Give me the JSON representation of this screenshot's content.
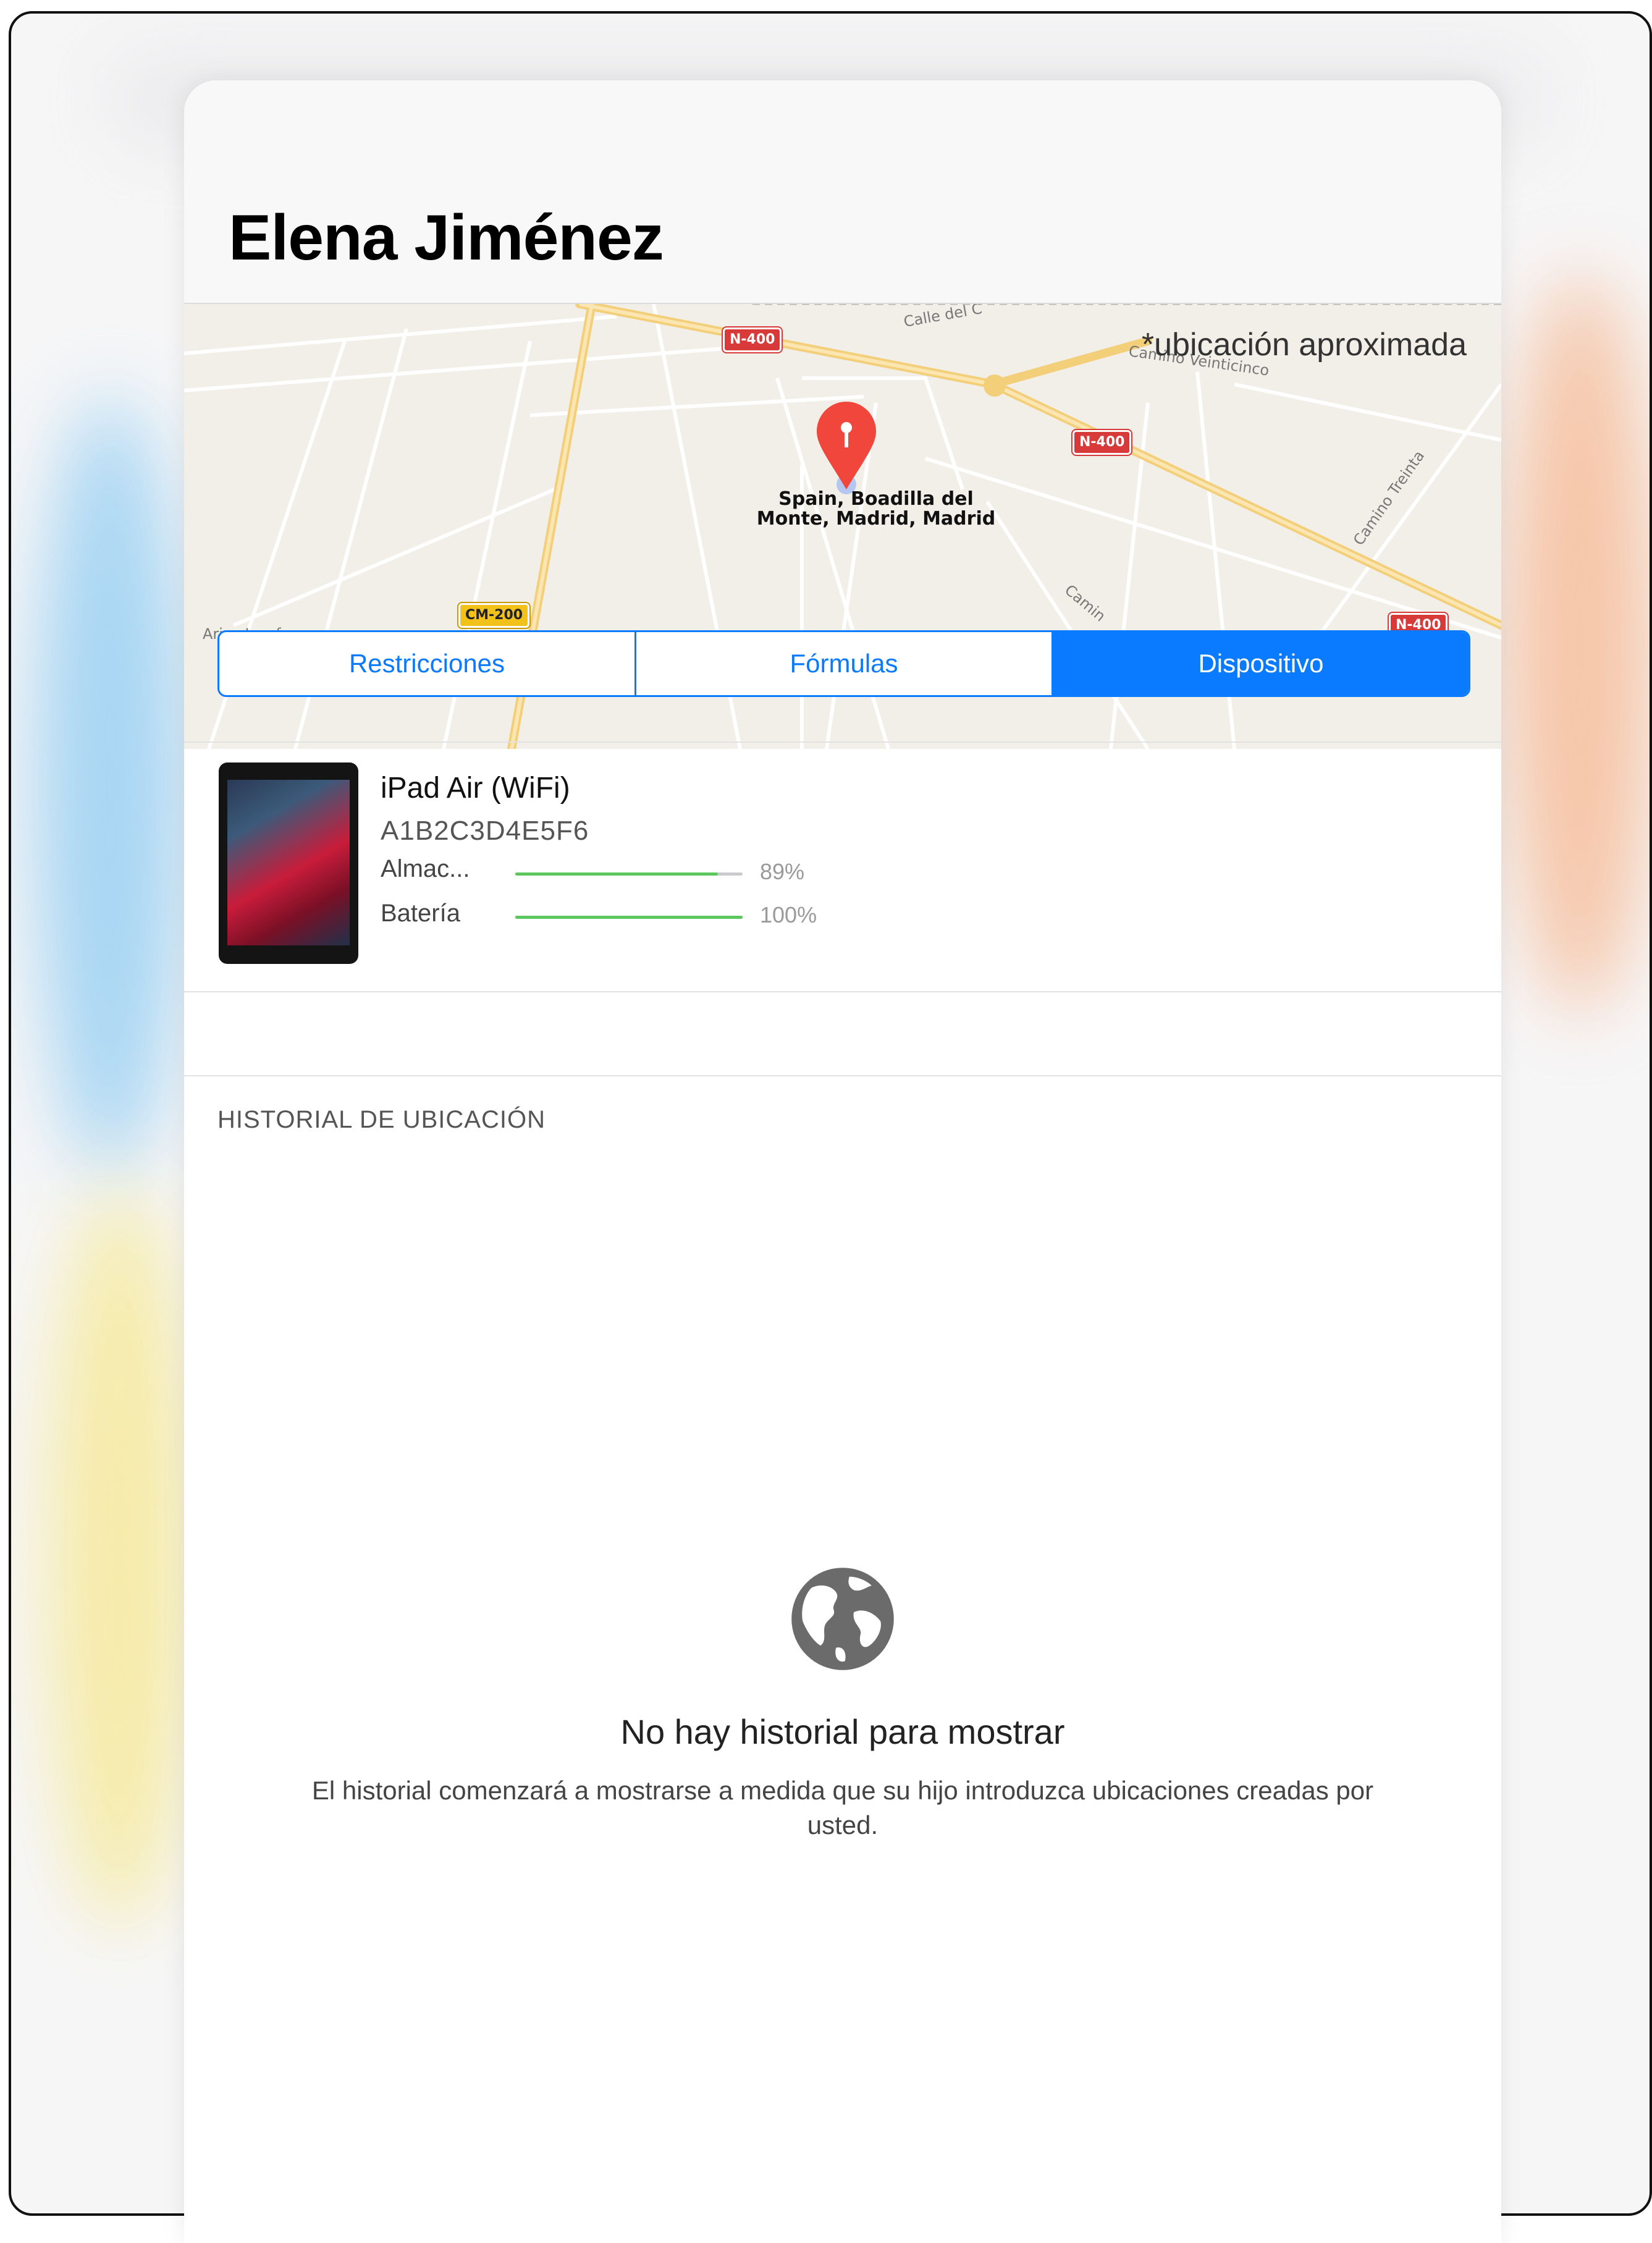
{
  "profile": {
    "name": "Elena Jiménez"
  },
  "map": {
    "note": "*ubicación aproximada",
    "place_line1": "Spain, Boadilla del",
    "place_line2": "Monte, Madrid, Madrid",
    "road_labels": [
      "Calle del C",
      "Camino Veinticinco",
      "Camino Treinta",
      "Camin",
      "Arica Jecaf"
    ],
    "shields": [
      "N-400",
      "N-400",
      "N-400",
      "CM-200"
    ]
  },
  "tabs": [
    {
      "label": "Restricciones",
      "active": false
    },
    {
      "label": "Fórmulas",
      "active": false
    },
    {
      "label": "Dispositivo",
      "active": true
    }
  ],
  "device": {
    "name": "iPad Air (WiFi)",
    "serial": "A1B2C3D4E5F6",
    "storage": {
      "label": "Almac...",
      "value_text": "89%",
      "fraction": 0.89
    },
    "battery": {
      "label": "Batería",
      "value_text": "100%",
      "fraction": 1.0
    }
  },
  "history": {
    "section_title": "HISTORIAL DE UBICACIÓN",
    "empty_icon": "globe-icon",
    "empty_title": "No hay historial para mostrar",
    "empty_description": "El historial comenzará a mostrarse a medida que su hijo introduzca ubicaciones creadas por usted."
  },
  "colors": {
    "accent": "#0a7aff",
    "pin": "#f0463c",
    "bar_fill": "#5cc75c",
    "bar_track": "#c9c9ce"
  }
}
